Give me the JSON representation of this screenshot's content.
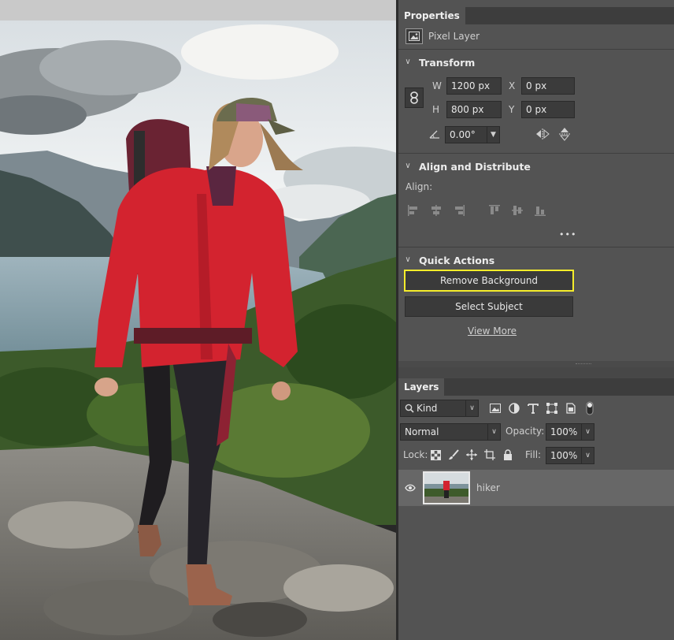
{
  "properties": {
    "tab_label": "Properties",
    "pixel_layer_label": "Pixel Layer",
    "transform": {
      "title": "Transform",
      "w_label": "W",
      "w_value": "1200 px",
      "h_label": "H",
      "h_value": "800 px",
      "x_label": "X",
      "x_value": "0 px",
      "y_label": "Y",
      "y_value": "0 px",
      "angle_value": "0.00°"
    },
    "align": {
      "title": "Align and Distribute",
      "align_label": "Align:",
      "more_label": "•••"
    },
    "quick_actions": {
      "title": "Quick Actions",
      "remove_background_label": "Remove Background",
      "select_subject_label": "Select Subject",
      "view_more_label": "View More"
    }
  },
  "layers": {
    "tab_label": "Layers",
    "filter_kind": "Kind",
    "blend_mode": "Normal",
    "opacity_label": "Opacity:",
    "opacity_value": "100%",
    "lock_label": "Lock:",
    "fill_label": "Fill:",
    "fill_value": "100%",
    "items": [
      {
        "name": "hiker",
        "visible": true,
        "selected": true
      }
    ]
  },
  "colors": {
    "panel_bg": "#535353",
    "highlight": "#f5ec2b",
    "jacket_red": "#d3232f"
  }
}
